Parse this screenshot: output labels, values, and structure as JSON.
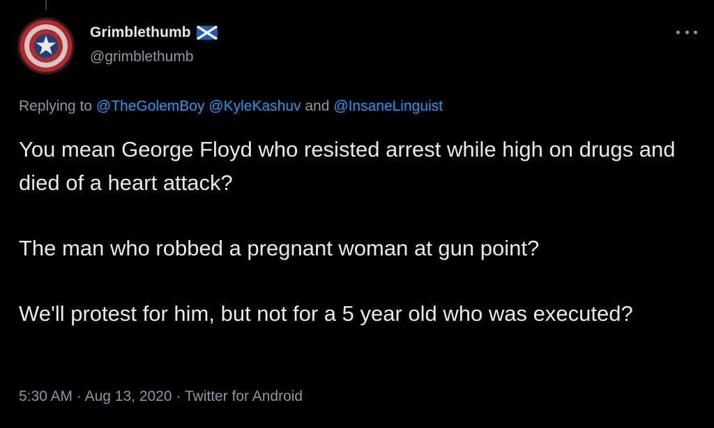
{
  "tweet": {
    "author": {
      "display_name": "Grimblethumb",
      "flag_icon": "scotland-flag-icon",
      "handle": "@grimblethumb",
      "avatar_icon": "captain-america-shield-icon"
    },
    "more_icon": "more-horizontal-icon",
    "reply": {
      "prefix": "Replying to",
      "mentions": [
        "@TheGolemBoy",
        "@KyleKashuv",
        "@InsaneLinguist"
      ],
      "conjunction": "and"
    },
    "paragraphs": [
      "You mean George Floyd who resisted arrest while high on drugs and died of a heart attack?",
      "The man who robbed a pregnant woman at gun point?",
      "We'll protest for him, but not for a 5 year old who was executed?"
    ],
    "meta": {
      "time": "5:30 AM",
      "separator": "·",
      "date": "Aug 13, 2020",
      "source": "Twitter for Android"
    }
  },
  "colors": {
    "background": "#000000",
    "text_primary": "#e7e9ea",
    "text_secondary": "#8b98a5",
    "link": "#1d9bf0"
  }
}
